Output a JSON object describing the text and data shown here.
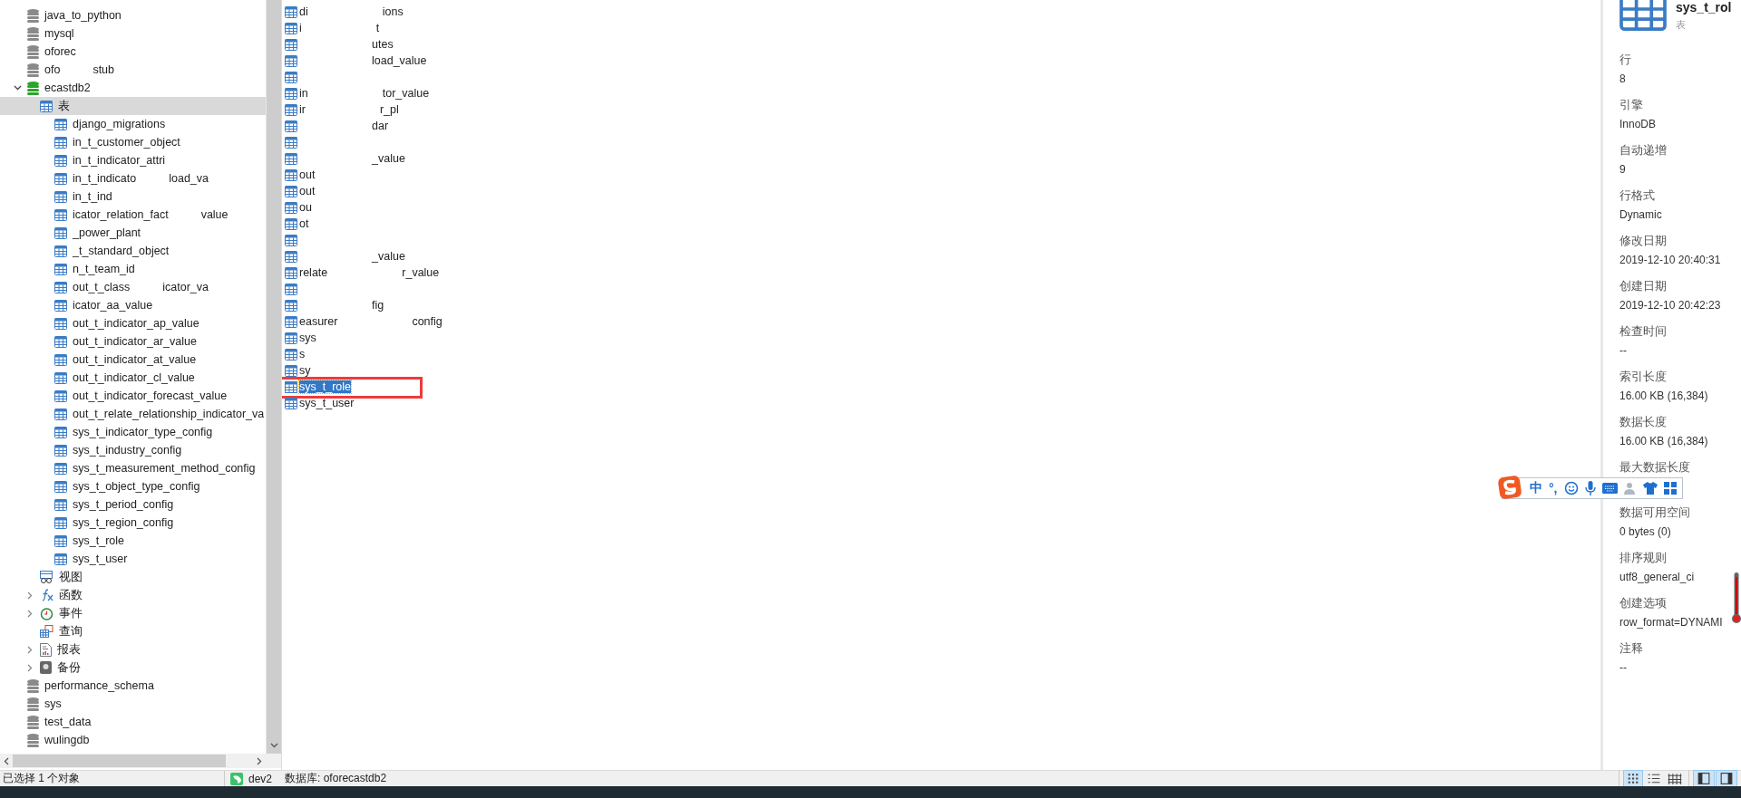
{
  "tree": [
    {
      "name": "java_to_python",
      "kind": "database",
      "open": false,
      "selected": false
    },
    {
      "name": "mysql",
      "kind": "database",
      "open": false,
      "selected": false
    },
    {
      "name": "oforec",
      "kind": "database",
      "open": false,
      "selected": false
    },
    {
      "name": "ofo",
      "tail": "stub",
      "kind": "database",
      "open": false,
      "selected": false
    },
    {
      "name": "ecastdb2",
      "kind": "database",
      "open": true,
      "expanded": true,
      "selected": false,
      "children": [
        {
          "name": "表",
          "kind": "tables",
          "selected": true,
          "children": [
            {
              "name": "django_migrations",
              "kind": "table",
              "selected": false
            },
            {
              "name": "in_t_customer_object",
              "kind": "table",
              "selected": false
            },
            {
              "name": "in_t_indicator_attri",
              "kind": "table",
              "selected": false
            },
            {
              "name": "in_t_indicato",
              "tail": "load_va",
              "kind": "table",
              "selected": false
            },
            {
              "name": "in_t_ind",
              "kind": "table",
              "selected": false
            },
            {
              "name": "icator_relation_fact",
              "tail": "value",
              "kind": "table",
              "selected": false
            },
            {
              "name": "_power_plant",
              "kind": "table",
              "selected": false
            },
            {
              "name": "_t_standard_object",
              "kind": "table",
              "selected": false
            },
            {
              "name": "n_t_team_id",
              "kind": "table",
              "selected": false
            },
            {
              "name": "out_t_class",
              "tail": "icator_va",
              "kind": "table",
              "selected": false
            },
            {
              "name": "icator_aa_value",
              "kind": "table",
              "selected": false
            },
            {
              "name": "out_t_indicator_ap_value",
              "kind": "table",
              "selected": false
            },
            {
              "name": "out_t_indicator_ar_value",
              "kind": "table",
              "selected": false
            },
            {
              "name": "out_t_indicator_at_value",
              "kind": "table",
              "selected": false
            },
            {
              "name": "out_t_indicator_cl_value",
              "kind": "table",
              "selected": false
            },
            {
              "name": "out_t_indicator_forecast_value",
              "kind": "table",
              "selected": false
            },
            {
              "name": "out_t_relate_relationship_indicator_va",
              "kind": "table",
              "selected": false
            },
            {
              "name": "sys_t_indicator_type_config",
              "kind": "table",
              "selected": false
            },
            {
              "name": "sys_t_industry_config",
              "kind": "table",
              "selected": false
            },
            {
              "name": "sys_t_measurement_method_config",
              "kind": "table",
              "selected": false
            },
            {
              "name": "sys_t_object_type_config",
              "kind": "table",
              "selected": false
            },
            {
              "name": "sys_t_period_config",
              "kind": "table",
              "selected": false
            },
            {
              "name": "sys_t_region_config",
              "kind": "table",
              "selected": false
            },
            {
              "name": "sys_t_role",
              "kind": "table",
              "selected": false
            },
            {
              "name": "sys_t_user",
              "kind": "table",
              "selected": false
            }
          ]
        },
        {
          "name": "视图",
          "kind": "views",
          "selected": false
        },
        {
          "name": "函数",
          "kind": "functions",
          "expanded": false,
          "selected": false
        },
        {
          "name": "事件",
          "kind": "events",
          "expanded": false,
          "selected": false
        },
        {
          "name": "查询",
          "kind": "queries",
          "selected": false
        },
        {
          "name": "报表",
          "kind": "reports",
          "expanded": false,
          "selected": false
        },
        {
          "name": "备份",
          "kind": "backups",
          "expanded": false,
          "selected": false
        }
      ]
    },
    {
      "name": "performance_schema",
      "kind": "database",
      "open": false,
      "selected": false
    },
    {
      "name": "sys",
      "kind": "database",
      "open": false,
      "selected": false
    },
    {
      "name": "test_data",
      "kind": "database",
      "open": false,
      "selected": false
    },
    {
      "name": "wulingdb",
      "kind": "database",
      "open": false,
      "selected": false
    }
  ],
  "objects": [
    {
      "head": "di",
      "tail": "ions",
      "selected": false,
      "marked": false
    },
    {
      "head": "i",
      "tail": "t",
      "selected": false,
      "marked": false
    },
    {
      "tail": "utes",
      "selected": false,
      "marked": false
    },
    {
      "tail": "load_value",
      "selected": false,
      "marked": false
    },
    {
      "selected": false,
      "marked": false
    },
    {
      "head": "in",
      "tail": "tor_value",
      "selected": false,
      "marked": false
    },
    {
      "head": "ir",
      "tail": "r_pl",
      "selected": false,
      "marked": false
    },
    {
      "tail": "dar",
      "selected": false,
      "marked": false
    },
    {
      "selected": false,
      "marked": false
    },
    {
      "tail": "_value",
      "selected": false,
      "marked": false
    },
    {
      "head": "out",
      "selected": false,
      "marked": false
    },
    {
      "head": "out",
      "selected": false,
      "marked": false
    },
    {
      "head": "ou",
      "selected": false,
      "marked": false
    },
    {
      "head": "ot",
      "selected": false,
      "marked": false
    },
    {
      "selected": false,
      "marked": false
    },
    {
      "tail": "_value",
      "selected": false,
      "marked": false
    },
    {
      "head": "relate",
      "tail": "r_value",
      "selected": false,
      "marked": false
    },
    {
      "selected": false,
      "marked": false
    },
    {
      "tail": "fig",
      "selected": false,
      "marked": false
    },
    {
      "head": "easurer",
      "tail": "config",
      "selected": false,
      "marked": false
    },
    {
      "head": "sys",
      "selected": false,
      "marked": false
    },
    {
      "head": "s",
      "selected": false,
      "marked": false
    },
    {
      "head": "sy",
      "selected": false,
      "marked": false
    },
    {
      "head": "sys_t_role",
      "selected": true,
      "marked": true
    },
    {
      "head": "sys_t_user",
      "selected": false,
      "marked": false
    }
  ],
  "info_panel": {
    "title": "sys_t_rol",
    "subtitle": "表",
    "properties": [
      {
        "label": "行",
        "value": "8"
      },
      {
        "label": "引擎",
        "value": "InnoDB"
      },
      {
        "label": "自动递增",
        "value": "9"
      },
      {
        "label": "行格式",
        "value": "Dynamic"
      },
      {
        "label": "修改日期",
        "value": "2019-12-10 20:40:31"
      },
      {
        "label": "创建日期",
        "value": "2019-12-10 20:42:23"
      },
      {
        "label": "检查时间",
        "value": "--"
      },
      {
        "label": "索引长度",
        "value": "16.00 KB (16,384)"
      },
      {
        "label": "数据长度",
        "value": "16.00 KB (16,384)"
      },
      {
        "label": "最大数据长度"
      },
      {
        "label": "数据可用空间",
        "value": "0 bytes (0)"
      },
      {
        "label": "排序规则",
        "value": "utf8_general_ci"
      },
      {
        "label": "创建选项",
        "value": "row_format=DYNAMI"
      },
      {
        "label": "注释",
        "value": "--"
      }
    ]
  },
  "ime_toolbar": {
    "mode": "中",
    "punctuation": "°,"
  },
  "status_bar": {
    "selection": "已选择 1 个对象",
    "connection": "dev2",
    "database": "数据库: oforecastdb2",
    "view_buttons": [
      {
        "kind": "icons",
        "selected": true
      },
      {
        "kind": "list",
        "selected": false
      },
      {
        "kind": "detail",
        "selected": false
      }
    ],
    "pane_toggles": [
      {
        "kind": "left",
        "on": true
      },
      {
        "kind": "right",
        "on": true
      }
    ]
  }
}
